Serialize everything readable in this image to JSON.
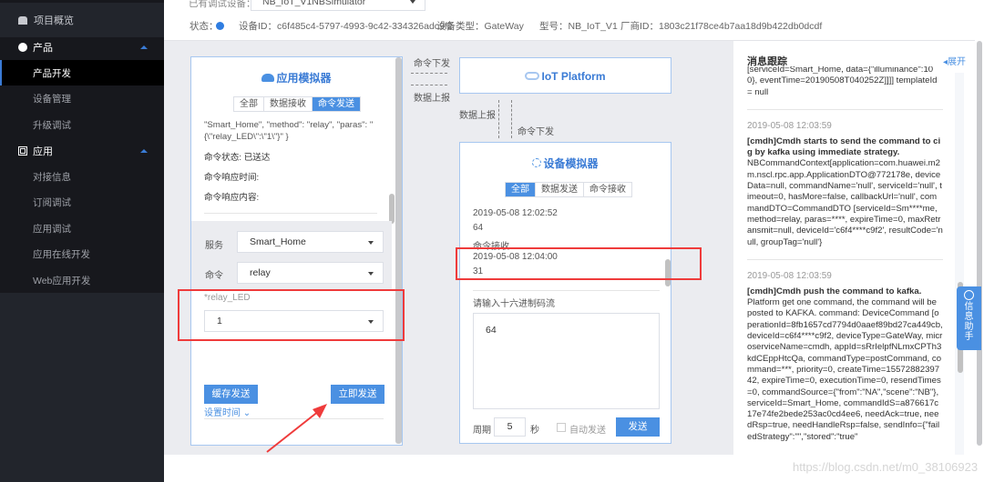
{
  "sidebar": {
    "overview": "项目概览",
    "product_group": "产品",
    "product_items": [
      "产品开发",
      "设备管理",
      "升级调试"
    ],
    "app_group": "应用",
    "app_items": [
      "对接信息",
      "订阅调试",
      "应用调试",
      "应用在线开发",
      "Web应用开发"
    ]
  },
  "header": {
    "device_label": "已有调试设备：",
    "device_select": "NB_IoT_V1NBSimulator",
    "status_label": "状态：",
    "status_color": "#2f7de1",
    "device_id": "设备ID：c6f485c4-5797-4993-9c42-334326adc9f2",
    "device_type": "设备类型：GateWay",
    "model": "型号：NB_IoT_V1",
    "vendor_id": "厂商ID：1803c21f78ce4b7aa18d9b422db0dcdf"
  },
  "app_sim": {
    "title": "应用模拟器",
    "tabs": [
      "全部",
      "数据接收",
      "命令发送"
    ],
    "log_line1": "\"Smart_Home\", \"method\": \"relay\", \"paras\": \"",
    "log_line2": "{\\\"relay_LED\\\":\\\"1\\\"}\" }",
    "cmd_status": "命令状态: 已送达",
    "cmd_resp_time": "命令响应时间:",
    "cmd_resp_content": "命令响应内容:",
    "service_label": "服务",
    "service_value": "Smart_Home",
    "command_label": "命令",
    "command_value": "relay",
    "param_label": "*relay_LED",
    "param_value": "1",
    "cache_send": "缓存发送",
    "send_now": "立即发送",
    "set_time": "设置时间"
  },
  "flow": {
    "cmd_down": "命令下发",
    "data_up": "数据上报",
    "platform": "IoT Platform"
  },
  "dev_sim": {
    "title": "设备模拟器",
    "tabs": [
      "全部",
      "数据发送",
      "命令接收"
    ],
    "entries": [
      {
        "time": "2019-05-08 12:02:52",
        "value": "64"
      },
      {
        "label": "命令接收",
        "time": "2019-05-08 12:04:00",
        "value": "31"
      }
    ],
    "hex_label": "请输入十六进制码流",
    "hex_value": "64",
    "period_label": "周期",
    "period_value": "5",
    "period_unit": "秒",
    "auto_send": "自动发送",
    "send": "发送"
  },
  "trace": {
    "title": "消息跟踪",
    "expand": "展开",
    "top_text": "[serviceId=Smart_Home, data={\"illuminance\":100}, eventTime=20190508T040252Z]]]] templateId = null",
    "messages": [
      {
        "time": "2019-05-08 12:03:59",
        "head": "[cmdh]Cmdh starts to send the command to cig by kafka using immediate strategy.",
        "body": "NBCommandContext[application=com.huawei.m2m.nscl.rpc.app.ApplicationDTO@772178e, deviceData=null, commandName='null', serviceId='null', timeout=0, hasMore=false, callbackUrl='null', commandDTO=CommandDTO [serviceId=Sm****me, method=relay, paras=****, expireTime=0, maxRetransmit=null, deviceId='c6f4****c9f2', resultCode='null, groupTag='null'}"
      },
      {
        "time": "2019-05-08 12:03:59",
        "head": "[cmdh]Cmdh push the command to kafka.",
        "body": "Platform get one command, the command will be posted to KAFKA. command: DeviceCommand [operationId=8fb1657cd7794d0aaef89bd27ca449cb, deviceId=c6f4****c9f2, deviceType=GateWay, microserviceName=cmdh, appId=sRrIelpfNLmxCPTh3kdCEppHtcQa, commandType=postCommand, command=***, priority=0, createTime=1557288239742, expireTime=0, executionTime=0, resendTimes=0, commandSource={\"from\":\"NA\",\"scene\":\"NB\"}, serviceId=Smart_Home, commandIdS=a876617c17e74fe2bede253ac0cd4ee6, needAck=true, needRsp=true, needHandleRsp=false, sendInfo={\"failedStrategy\":\"\",\"stored\":\"true\""
      }
    ],
    "help": "信息助手"
  },
  "watermark": "https://blog.csdn.net/m0_38106923"
}
